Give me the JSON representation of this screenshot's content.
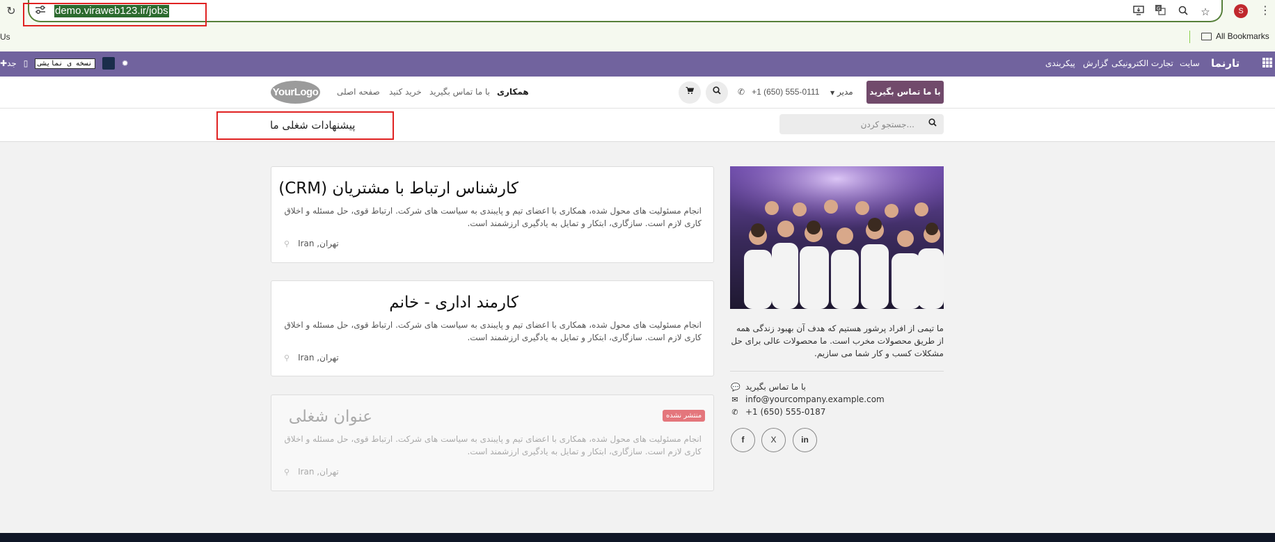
{
  "browser": {
    "url": "demo.viraweb123.ir/jobs",
    "bookmarks_left": "Us",
    "bookmarks_right": "All Bookmarks",
    "profile_initial": "S"
  },
  "admin_bar": {
    "brand": "تارنما",
    "menu": [
      "سایت",
      "تجارت الکترونیکی",
      "گزارش",
      "پیکربندی"
    ],
    "version_badge": "نسخه ی نمایشی",
    "left_tag": "جد",
    "accent_color": "#71639e"
  },
  "site_header": {
    "cta": "با ما تماس بگیرید",
    "user": "مدیر",
    "phone": "+1 (650) 555-0111",
    "nav": [
      "همکاری",
      "با ما تماس بگیرید",
      "خرید کنید",
      "صفحه اصلی"
    ],
    "logo": "YourLogo",
    "cta_color": "#714a6b"
  },
  "sub_header": {
    "title": "پیشنهادات شغلی ما",
    "search_placeholder": "...جستجو کردن"
  },
  "jobs": [
    {
      "title": "کارشناس ارتباط با مشتریان (CRM)",
      "description": "انجام مسئولیت های محول شده، همکاری با اعضای تیم و پایبندی به سیاست های شرکت. ارتباط قوی، حل مسئله و اخلاق کاری لازم است. سازگاری، ابتکار و تمایل به یادگیری ارزشمند است.",
      "location": "Iran ,تهران"
    },
    {
      "title": "کارمند اداری - خانم",
      "description": "انجام مسئولیت های محول شده، همکاری با اعضای تیم و پایبندی به سیاست های شرکت. ارتباط قوی، حل مسئله و اخلاق کاری لازم است. سازگاری، ابتکار و تمایل به یادگیری ارزشمند است.",
      "location": "Iran ,تهران"
    },
    {
      "title": "عنوان شغلی",
      "description": "انجام مسئولیت های محول شده، همکاری با اعضای تیم و پایبندی به سیاست های شرکت. ارتباط قوی، حل مسئله و اخلاق کاری لازم است. سازگاری، ابتکار و تمایل به یادگیری ارزشمند است.",
      "location": "Iran ,تهران",
      "badge": "منتشر نشده"
    }
  ],
  "sidebar": {
    "about": "ما تیمی از افراد پرشور هستیم که هدف آن بهبود زندگی همه از طریق محصولات مخرب است. ما محصولات عالی برای حل مشکلات کسب و کار شما می سازیم.",
    "contact_label": "با ما تماس بگیرید",
    "email": "info@yourcompany.example.com",
    "phone": "+1 (650) 555-0187",
    "social": [
      "f",
      "X",
      "in"
    ]
  }
}
